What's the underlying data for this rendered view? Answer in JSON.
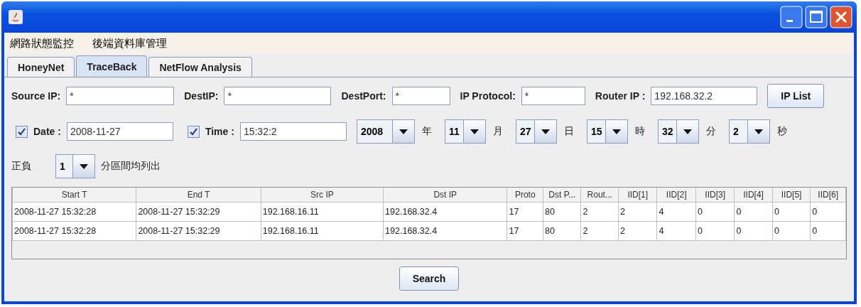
{
  "menu": [
    "網路狀態監控",
    "後端資料庫管理"
  ],
  "tabs": [
    {
      "label": "HoneyNet",
      "selected": false
    },
    {
      "label": "TraceBack",
      "selected": true
    },
    {
      "label": "NetFlow Analysis",
      "selected": false
    }
  ],
  "filters": [
    {
      "label": "Source IP:",
      "value": "*"
    },
    {
      "label": "DestIP:",
      "value": "*"
    },
    {
      "label": "DestPort:",
      "value": "*"
    },
    {
      "label": "IP Protocol:",
      "value": "*"
    },
    {
      "label": "Router IP :",
      "value": "192.168.32.2"
    }
  ],
  "ip_list_button": "IP List",
  "date": {
    "label": "Date :",
    "checked": true,
    "value": "2008-11-27"
  },
  "time": {
    "label": "Time :",
    "checked": true,
    "value": "15:32:2"
  },
  "pickers": [
    {
      "value": "2008",
      "unit": "年"
    },
    {
      "value": "11",
      "unit": "月"
    },
    {
      "value": "27",
      "unit": "日"
    },
    {
      "value": "15",
      "unit": "時"
    },
    {
      "value": "32",
      "unit": "分"
    },
    {
      "value": "2",
      "unit": "秒"
    }
  ],
  "range": {
    "label": "正負",
    "value": "1",
    "suffix": "分區間均列出"
  },
  "table": {
    "columns": [
      "Start T",
      "End T",
      "Src IP",
      "Dst IP",
      "Proto",
      "Dst P...",
      "Rout...",
      "IID[1]",
      "IID[2]",
      "IID[3]",
      "IID[4]",
      "IID[5]",
      "IID[6]"
    ],
    "rows": [
      [
        "2008-11-27 15:32:28",
        "2008-11-27 15:32:29",
        "192.168.16.11",
        "192.168.32.4",
        "17",
        "80",
        "2",
        "2",
        "4",
        "0",
        "0",
        "0",
        "0"
      ],
      [
        "2008-11-27 15:32:28",
        "2008-11-27 15:32:29",
        "192.168.16.11",
        "192.168.32.4",
        "17",
        "80",
        "2",
        "2",
        "4",
        "0",
        "0",
        "0",
        "0"
      ]
    ]
  },
  "search_button": "Search"
}
